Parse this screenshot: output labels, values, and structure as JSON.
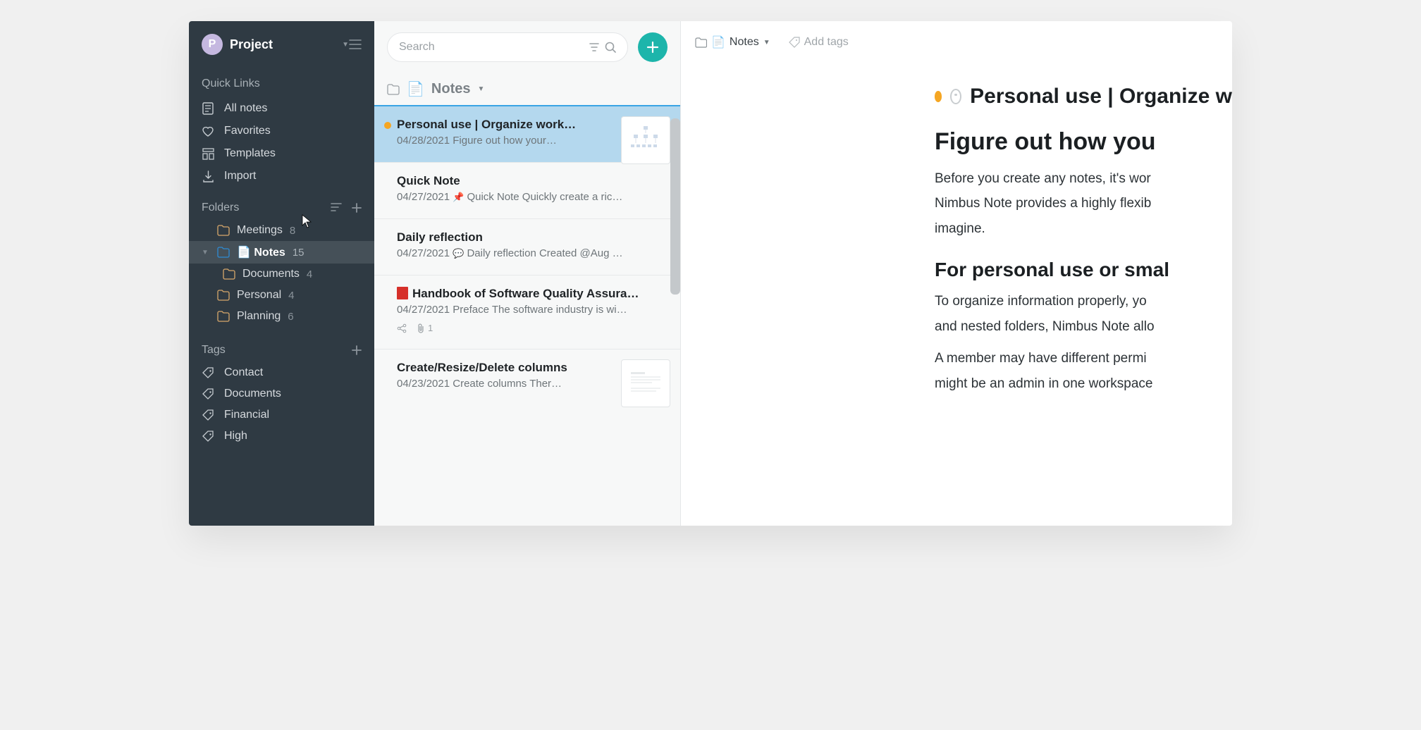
{
  "workspace": {
    "avatar_initial": "P",
    "name": "Project"
  },
  "quick_links": {
    "header": "Quick Links",
    "items": [
      {
        "label": "All notes",
        "icon": "note-icon"
      },
      {
        "label": "Favorites",
        "icon": "heart-icon"
      },
      {
        "label": "Templates",
        "icon": "templates-icon"
      },
      {
        "label": "Import",
        "icon": "import-icon"
      }
    ]
  },
  "folders": {
    "header": "Folders",
    "items": [
      {
        "label": "Meetings",
        "count": "8",
        "color": "#d8a86b",
        "selected": false,
        "indent": 0
      },
      {
        "label": "📄 Notes",
        "count": "15",
        "color": "#2e8bd4",
        "selected": true,
        "indent": 0,
        "expanded": true
      },
      {
        "label": "Documents",
        "count": "4",
        "color": "#d8a86b",
        "selected": false,
        "indent": 1
      },
      {
        "label": "Personal",
        "count": "4",
        "color": "#d8a86b",
        "selected": false,
        "indent": 0
      },
      {
        "label": "Planning",
        "count": "6",
        "color": "#d8a86b",
        "selected": false,
        "indent": 0
      }
    ]
  },
  "tags": {
    "header": "Tags",
    "items": [
      {
        "label": "Contact"
      },
      {
        "label": "Documents"
      },
      {
        "label": "Financial"
      },
      {
        "label": "High"
      }
    ]
  },
  "notelist": {
    "search_placeholder": "Search",
    "breadcrumb": {
      "emoji": "📄",
      "label": "Notes"
    },
    "items": [
      {
        "marker_color": "#f5a623",
        "title": "Personal use | Organize work…",
        "date": "04/28/2021",
        "excerpt": "Figure out how your…",
        "selected": true,
        "thumb": true
      },
      {
        "title": "Quick Note",
        "date": "04/27/2021",
        "pin": true,
        "excerpt": "Quick Note Quickly create a ric…"
      },
      {
        "title": "Daily reflection",
        "date": "04/27/2021",
        "chat": true,
        "excerpt": "Daily reflection Created @Aug …"
      },
      {
        "book": true,
        "title": "Handbook of Software Quality Assura…",
        "date": "04/27/2021",
        "excerpt": "Preface The software industry is wi…",
        "share": true,
        "attach": "1"
      },
      {
        "title": "Create/Resize/Delete columns",
        "date": "04/23/2021",
        "excerpt": "Create columns Ther…",
        "thumb": true
      }
    ]
  },
  "editor": {
    "bc_folder_emoji": "📄",
    "bc_folder_label": "Notes",
    "addtags": "Add tags",
    "title": "Personal use | Organize w",
    "h1": "Figure out how you",
    "p1a": "Before you create any notes, it's wor",
    "p1b": "Nimbus Note provides a highly flexib",
    "p1c": "imagine.",
    "h2": "For personal use or smal",
    "p2a": "To organize information properly, yo",
    "p2b": "and nested folders, Nimbus Note allo",
    "p3a": "A member may have different permi",
    "p3b": "might be an admin in one workspace"
  }
}
